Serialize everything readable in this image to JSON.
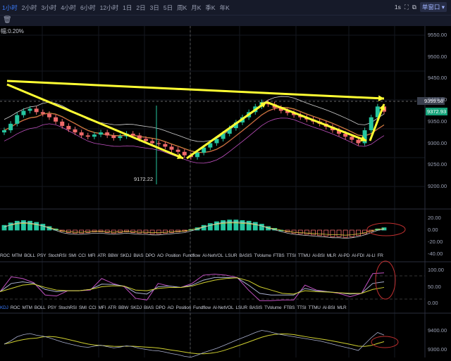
{
  "topbar": {
    "intervals": [
      "1小时",
      "2小时",
      "3小时",
      "4小时",
      "6小时",
      "12小时",
      "1日",
      "2日",
      "3日",
      "5日",
      "周K",
      "月K",
      "季K",
      "年K"
    ],
    "active_interval": "1小时",
    "refresh": "1s",
    "window_select": "单窗口 ▾"
  },
  "toolbar": {
    "trash_icon": "trash-icon"
  },
  "main": {
    "change_label": "幅:0.20%",
    "price_ticks": [
      "9550.00",
      "9500.00",
      "9450.00",
      "9400.00",
      "9350.00",
      "9300.00",
      "9250.00",
      "9200.00"
    ],
    "crosshair_price": "9399.58",
    "last_price": "9372.93",
    "low_label": "9172.22",
    "colors": {
      "up": "#26c6a0",
      "down": "#ef6b6b",
      "annotation": "#ffff33"
    }
  },
  "chart_data": {
    "type": "candlestick",
    "closes": [
      9330,
      9345,
      9365,
      9375,
      9380,
      9372,
      9368,
      9360,
      9350,
      9340,
      9332,
      9325,
      9318,
      9315,
      9320,
      9325,
      9318,
      9312,
      9316,
      9322,
      9318,
      9310,
      9305,
      9300,
      9298,
      9292,
      9285,
      9280,
      9272,
      9268,
      9278,
      9290,
      9300,
      9310,
      9322,
      9335,
      9348,
      9360,
      9372,
      9385,
      9395,
      9390,
      9382,
      9375,
      9370,
      9365,
      9360,
      9355,
      9350,
      9345,
      9338,
      9330,
      9322,
      9315,
      9308,
      9300,
      9330,
      9360,
      9385,
      9373
    ],
    "macd_hist": [
      8,
      12,
      15,
      16,
      15,
      13,
      10,
      6,
      2,
      -2,
      -4,
      -5,
      -5,
      -4,
      -3,
      -3,
      -4,
      -5,
      -4,
      -3,
      -4,
      -5,
      -5,
      -6,
      -6,
      -5,
      -4,
      -3,
      -2,
      1,
      4,
      8,
      11,
      14,
      16,
      17,
      17,
      16,
      15,
      13,
      10,
      6,
      3,
      0,
      -3,
      -5,
      -6,
      -7,
      -8,
      -9,
      -10,
      -11,
      -11,
      -12,
      -11,
      -9,
      -6,
      -2,
      2,
      4
    ],
    "macd_ticks": [
      "20.00",
      "0.00",
      "-20.00",
      "-40.00"
    ],
    "kdj_ticks": [
      "100.00",
      "50.00",
      "0.00"
    ],
    "kdj": {
      "K": [
        35,
        80,
        75,
        62,
        25,
        22,
        38,
        38,
        40,
        75,
        60,
        50,
        15,
        10,
        60,
        52,
        48,
        60,
        85,
        88,
        85,
        78,
        40,
        8,
        8,
        10,
        10,
        55,
        40,
        35,
        30,
        20,
        30,
        90,
        92
      ],
      "D": [
        35,
        60,
        65,
        60,
        42,
        35,
        38,
        38,
        42,
        58,
        57,
        52,
        32,
        28,
        50,
        52,
        48,
        55,
        70,
        78,
        78,
        77,
        55,
        30,
        25,
        25,
        25,
        45,
        38,
        35,
        32,
        28,
        30,
        60,
        65
      ],
      "J": [
        35,
        45,
        55,
        58,
        48,
        40,
        38,
        38,
        42,
        50,
        53,
        52,
        40,
        38,
        45,
        48,
        48,
        52,
        62,
        70,
        75,
        77,
        68,
        50,
        40,
        30,
        28,
        38,
        35,
        34,
        32,
        30,
        30,
        42,
        48
      ]
    },
    "bottom_ticks": [
      "9400.00",
      "9300.00"
    ]
  },
  "macd_tabs": [
    "ROC",
    "MTM",
    "BOLL",
    "PSY",
    "StochRSI",
    "SMI",
    "CCI",
    "MFI",
    "ATR",
    "BBW",
    "SKDJ",
    "BIAS",
    "DPO",
    "AO",
    "Position",
    "Fundflow",
    "AI-NetVOL",
    "LSUR",
    "BASIS",
    "TVolume",
    "FTBS",
    "TTSI",
    "TTMU",
    "AI-BSI",
    "MLR",
    "AI-PD",
    "AI-FDI",
    "AI-LI",
    "FR"
  ],
  "kdj_tabs": [
    "KDJ",
    "ROC",
    "MTM",
    "BOLL",
    "PSY",
    "StochRSI",
    "SMI",
    "CCI",
    "MFI",
    "ATR",
    "BBW",
    "SKDJ",
    "BIAS",
    "DPO",
    "AO",
    "Position",
    "Fundflow",
    "AI-NetVOL",
    "LSUR",
    "BASIS",
    "TVolume",
    "FTBS",
    "TTSI",
    "TTMU",
    "AI-BSI",
    "MLR"
  ]
}
